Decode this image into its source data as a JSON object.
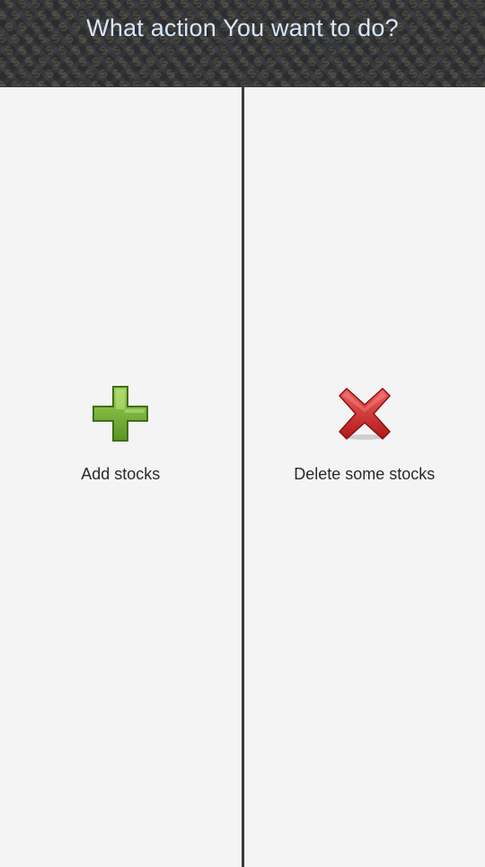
{
  "header": {
    "title": "What action You want to do?"
  },
  "actions": [
    {
      "label": "Add stocks",
      "icon": "plus-icon",
      "color": "#6aa22a"
    },
    {
      "label": "Delete some stocks",
      "icon": "cross-icon",
      "color": "#d62f2f"
    }
  ],
  "colors": {
    "header_bg": "#2b2d31",
    "header_text": "#d8e6f8",
    "panel_bg": "#f4f4f4",
    "divider": "#3a3a3a"
  }
}
